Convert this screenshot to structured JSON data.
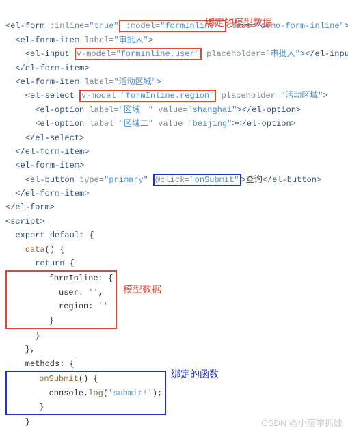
{
  "code": {
    "line1_a": "<el-form :inline=\"true\"",
    "line1_b": " :model=\"formInline\" ",
    "line1_c": "class=\"demo-form-inline\">",
    "line2": "  <el-form-item label=\"审批人\">",
    "line3_a": "    <el-input ",
    "line3_b": "v-model=\"formInline.user\"",
    "line3_c": " placeholder=\"审批人\"></el-input>",
    "line4": "  </el-form-item>",
    "line5": "  <el-form-item label=\"活动区域\">",
    "line6_a": "    <el-select ",
    "line6_b": "v-model=\"formInline.region\"",
    "line6_c": " placeholder=\"活动区域\">",
    "line7": "      <el-option label=\"区域一\" value=\"shanghai\"></el-option>",
    "line8": "      <el-option label=\"区域二\" value=\"beijing\"></el-option>",
    "line9": "    </el-select>",
    "line10": "  </el-form-item>",
    "line11": "  <el-form-item>",
    "line12_a": "    <el-button type=\"primary\" ",
    "line12_b": "@click=\"onSubmit\"",
    "line12_c": ">查询</el-button>",
    "line13": "  </el-form-item>",
    "line14": "</el-form>",
    "line15": "<script>",
    "line16": "  export default {",
    "line17": "    data() {",
    "line18": "      return {",
    "line19": "        formInline: {",
    "line20": "          user: '',",
    "line21": "          region: ''",
    "line22": "        }",
    "line23": "      }",
    "line24": "    },",
    "line25": "    methods: {",
    "line26": "      onSubmit() {",
    "line27": "        console.log('submit!');",
    "line28": "      }",
    "line29": "    }"
  },
  "annotations": {
    "a1": "绑定的模型数据",
    "a2": "模型数据",
    "a3": "绑定的函数"
  },
  "watermark": "CSDN @小唐学抓娃"
}
